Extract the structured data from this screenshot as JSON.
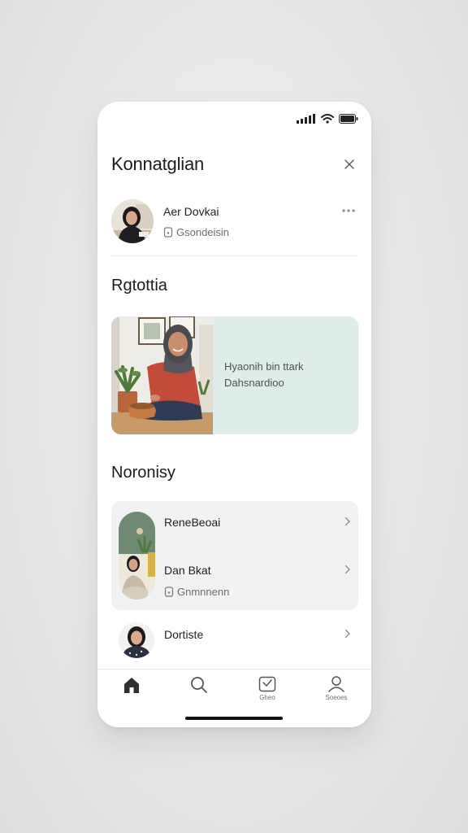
{
  "header": {
    "title": "Konnatglian"
  },
  "profile": {
    "name": "Aer Dovkai",
    "subtitle": "Gsondeisin"
  },
  "section_featured": {
    "title": "Rgtottia",
    "card_line1": "Hyaonih bin ttark",
    "card_line2": "Dahsnardioo"
  },
  "section_list": {
    "title": "Noronisy",
    "item1": {
      "title": "ReneBeoai"
    },
    "item2": {
      "title": "Dan  Bkat",
      "subtitle": "Gnmnnenn"
    },
    "item3": {
      "title": "Dortiste"
    }
  },
  "tabs": [
    {
      "icon": "home-icon",
      "label": ""
    },
    {
      "icon": "search-icon",
      "label": ""
    },
    {
      "icon": "message-icon",
      "label": "Gheo"
    },
    {
      "icon": "profile-icon",
      "label": "Soeoes"
    }
  ],
  "colors": {
    "card_tint": "#e0ecea",
    "group_card_bg": "#f1f2f4",
    "text_primary": "#1b1b1b",
    "text_secondary": "#6c6c6c"
  }
}
